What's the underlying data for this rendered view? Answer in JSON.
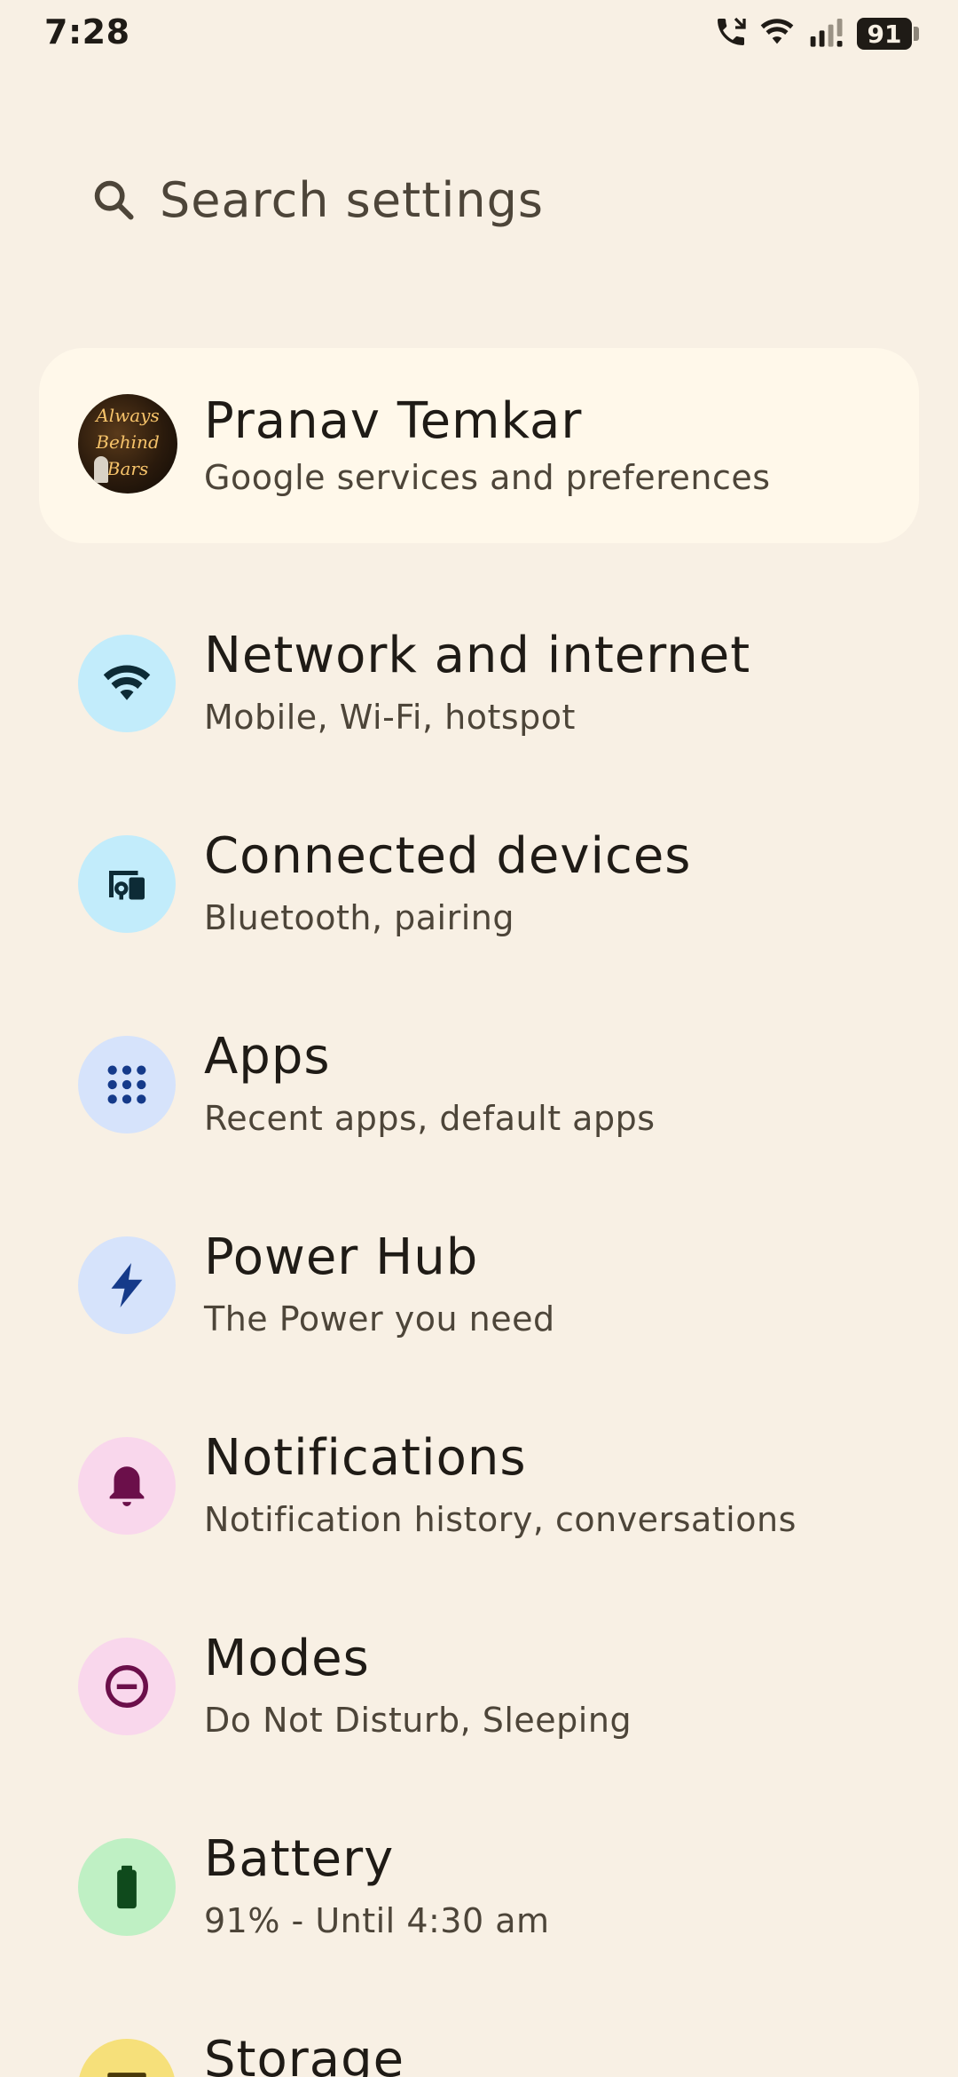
{
  "status_bar": {
    "time": "7:28",
    "battery_level": "91",
    "icons": [
      "call-icon",
      "wifi-icon",
      "signal-icon",
      "battery-icon"
    ]
  },
  "search": {
    "placeholder": "Search settings"
  },
  "account": {
    "name": "Pranav Temkar",
    "subtitle": "Google services and preferences",
    "avatar_text": [
      "Always",
      "Behind",
      "Bars"
    ]
  },
  "settings": [
    {
      "title": "Network and internet",
      "subtitle": "Mobile, Wi-Fi, hotspot",
      "icon": "wifi-icon",
      "icon_bg": "#c2ecfb",
      "icon_color": "#0d2b36"
    },
    {
      "title": "Connected devices",
      "subtitle": "Bluetooth, pairing",
      "icon": "devices-icon",
      "icon_bg": "#c2ecfb",
      "icon_color": "#0d2b36"
    },
    {
      "title": "Apps",
      "subtitle": "Recent apps, default apps",
      "icon": "apps-grid-icon",
      "icon_bg": "#d6e3fb",
      "icon_color": "#153a8a"
    },
    {
      "title": "Power Hub",
      "subtitle": "The Power you need",
      "icon": "bolt-icon",
      "icon_bg": "#d6e3fb",
      "icon_color": "#153a8a"
    },
    {
      "title": "Notifications",
      "subtitle": "Notification history, conversations",
      "icon": "bell-icon",
      "icon_bg": "#f9d7ec",
      "icon_color": "#6b0f4a"
    },
    {
      "title": "Modes",
      "subtitle": "Do Not Disturb, Sleeping",
      "icon": "modes-icon",
      "icon_bg": "#f9d7ec",
      "icon_color": "#6b0f4a"
    },
    {
      "title": "Battery",
      "subtitle": "91% - Until 4:30 am",
      "icon": "battery-icon",
      "icon_bg": "#bff0c4",
      "icon_color": "#0f4a1c"
    },
    {
      "title": "Storage",
      "subtitle": "",
      "icon": "storage-icon",
      "icon_bg": "#f6e07a",
      "icon_color": "#4a3a0a"
    }
  ]
}
